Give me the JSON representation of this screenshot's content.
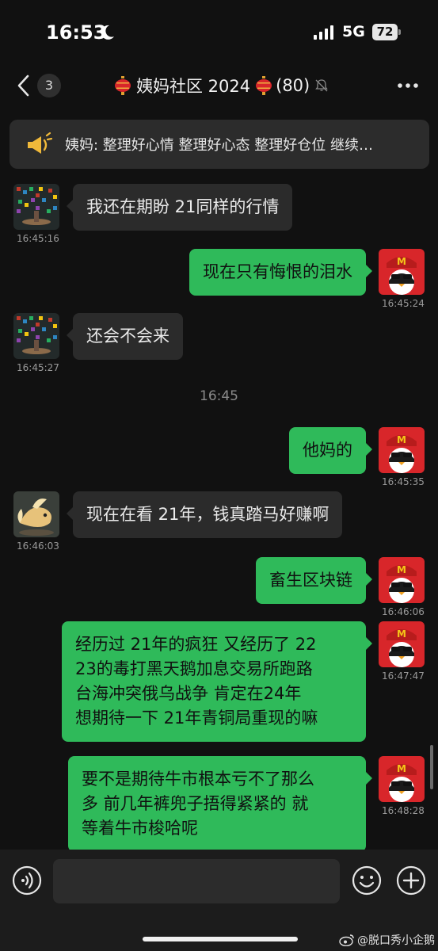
{
  "status_bar": {
    "time": "16:53",
    "network": "5G",
    "battery": "72"
  },
  "header": {
    "unread_count": "3",
    "title": "姨妈社区 2024",
    "member_count": "(80)"
  },
  "pinned": {
    "text": "姨妈: 整理好心情 整理好心态 整理好仓位 继续…"
  },
  "messages": [
    {
      "side": "in",
      "text": "我还在期盼 21同样的行情",
      "time": "16:45:16"
    },
    {
      "side": "out",
      "text": "现在只有悔恨的泪水",
      "time": "16:45:24"
    },
    {
      "side": "in",
      "text": "还会不会来",
      "time": "16:45:27"
    },
    {
      "side": "out",
      "text": "他妈的",
      "time": "16:45:35"
    },
    {
      "side": "in",
      "text": "现在在看 21年，钱真踏马好赚啊",
      "time": "16:46:03"
    },
    {
      "side": "out",
      "text": "畜生区块链",
      "time": "16:46:06"
    },
    {
      "side": "out",
      "lines": [
        "经历过 21年的疯狂 又经历了 22",
        "23的毒打黑天鹅加息交易所跑路",
        "台海冲突俄乌战争 肯定在24年",
        "想期待一下 21年青铜局重现的嘛"
      ],
      "time": "16:47:47"
    },
    {
      "side": "out",
      "lines": [
        "要不是期待牛市根本亏不了那么",
        "多 前几年裤兜子捂得紧紧的 就",
        "等着牛市梭哈呢"
      ],
      "time": "16:48:28"
    }
  ],
  "divider_time": "16:45",
  "input": {
    "placeholder": ""
  },
  "watermark": "@脱口秀小企鹅",
  "icons": {
    "moon": "moon-icon",
    "signal": "signal-icon",
    "back": "back-icon",
    "lantern": "lantern-icon",
    "mute": "mute-icon",
    "more": "more-icon",
    "pinned": "megaphone-icon",
    "voice": "voice-icon",
    "emoji": "emoji-icon",
    "plus": "plus-icon",
    "weibo": "weibo-icon"
  },
  "colors": {
    "background": "#111111",
    "incoming_bubble": "#2b2b2b",
    "outgoing_bubble": "#2fba5a",
    "accent_red": "#d8262a"
  }
}
